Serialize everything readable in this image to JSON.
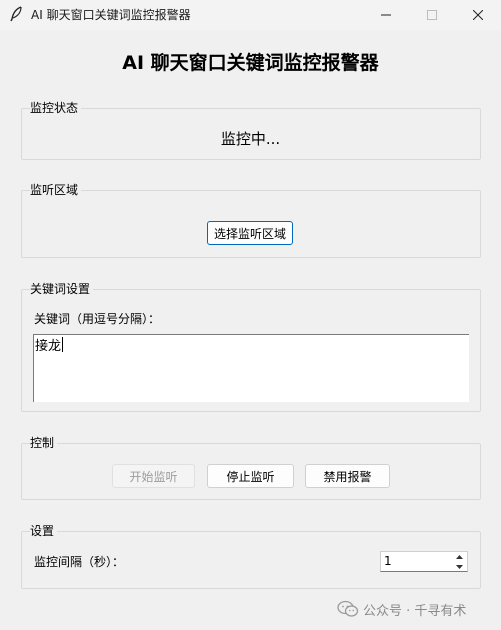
{
  "window": {
    "title": "AI 聊天窗口关键词监控报警器"
  },
  "header": {
    "title": "AI 聊天窗口关键词监控报警器"
  },
  "status_group": {
    "label": "监控状态",
    "status_text": "监控中..."
  },
  "area_group": {
    "label": "监听区域",
    "select_button": "选择监听区域"
  },
  "keywords_group": {
    "label": "关键词设置",
    "field_label": "关键词（用逗号分隔）：",
    "value": "接龙"
  },
  "control_group": {
    "label": "控制",
    "start_button": "开始监听",
    "stop_button": "停止监听",
    "disable_alarm_button": "禁用报警"
  },
  "settings_group": {
    "label": "设置",
    "interval_label": "监控间隔（秒）：",
    "interval_value": "1"
  },
  "watermark": {
    "text": "公众号 · 千寻有术"
  },
  "colors": {
    "accent": "#0067c0",
    "background": "#f0f0f0"
  },
  "icons": {
    "app": "feather-icon",
    "minimize": "minimize-icon",
    "maximize": "maximize-icon",
    "close": "close-icon"
  }
}
